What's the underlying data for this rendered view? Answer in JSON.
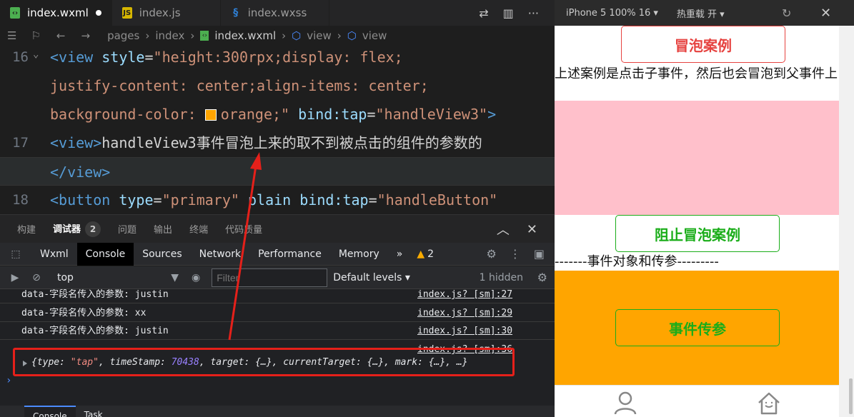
{
  "editor_tabs": [
    {
      "label": "index.wxml",
      "icon": "wxml-file-icon",
      "active": true,
      "dirty": true
    },
    {
      "label": "index.js",
      "icon": "js-file-icon",
      "active": false
    },
    {
      "label": "index.wxss",
      "icon": "wxss-file-icon",
      "active": false
    }
  ],
  "breadcrumb": {
    "items": [
      "pages",
      "index",
      "index.wxml",
      "view",
      "view"
    ]
  },
  "code": {
    "lines": [
      {
        "num": "16",
        "text": "<view style=\"height:300rpx;display: flex;"
      },
      {
        "num": "",
        "text": "justify-content: center;align-items: center;"
      },
      {
        "num": "",
        "text": "background-color: orange;\" bind:tap=\"handleView3\">"
      },
      {
        "num": "17",
        "text": "<view>handleView3事件冒泡上来的取不到被点击的组件的参数的"
      },
      {
        "num": "",
        "text": "</view>"
      },
      {
        "num": "18",
        "text": "<button type=\"primary\" plain bind:tap=\"handleButton\""
      }
    ],
    "line16": {
      "tag_open": "<view",
      "attr": "style",
      "eq": "=",
      "val1": "\"height:300rpx;display: flex;"
    },
    "line16b": "justify-content: center;align-items: center;",
    "line16c": {
      "prefix": "background-color: ",
      "color_word": "orange",
      "suffix": ";\"",
      "attr": "bind:tap",
      "eq": "=",
      "val": "\"handleView3\"",
      "close": ">"
    },
    "line17": {
      "tag": "<view>",
      "text": "handleView3事件冒泡上来的取不到被点击的组件的参数的"
    },
    "line17b": "</view>",
    "line18": {
      "tag_open": "<button",
      "attr1": "type",
      "eq": "=",
      "val1": "\"primary\"",
      "attr2": "plain",
      "attr3": "bind:tap",
      "val3": "\"handleButton\""
    },
    "swatch_color": "#ffa500"
  },
  "panel": {
    "tabs": [
      "构建",
      "调试器",
      "问题",
      "输出",
      "终端",
      "代码质量"
    ],
    "active_tab": "调试器",
    "debugger_badge": "2"
  },
  "devtools": {
    "tabs": [
      "Wxml",
      "Console",
      "Sources",
      "Network",
      "Performance",
      "Memory"
    ],
    "active": "Console",
    "more": "»",
    "warning_count": "2"
  },
  "console_toolbar": {
    "context": "top",
    "filter_placeholder": "Filter",
    "levels": "Default levels",
    "hidden": "1 hidden"
  },
  "console_logs": [
    {
      "msg": "data-字段名传入的参数: justin",
      "src": "index.js? [sm]:27"
    },
    {
      "msg": "data-字段名传入的参数: xx",
      "src": "index.js? [sm]:29"
    },
    {
      "msg": "data-字段名传入的参数: justin",
      "src": "index.js? [sm]:30"
    }
  ],
  "console_obj": {
    "src": "index.js? [sm]:36",
    "open": "{",
    "k1": "type: ",
    "v1": "\"tap\"",
    "k2": ", timeStamp: ",
    "v2": "70438",
    "rest": ", target: {…}, currentTarget: {…}, mark: {…}, …}"
  },
  "bottom_tabs": [
    "Console",
    "Task"
  ],
  "simulator": {
    "device": "iPhone 5 100% 16 ▾",
    "hot_reload": "热重载 开 ▾",
    "btn_bubble": "冒泡案例",
    "desc": "上述案例是点击子事件，然后也会冒泡到父事件上",
    "btn_stop": "阻止冒泡案例",
    "divider": "-------事件对象和传参---------",
    "btn_param": "事件传参",
    "tab_icons": [
      "user-icon",
      "home-icon"
    ]
  },
  "colors": {
    "pink": "#ffc0cb",
    "orange": "#ffa500",
    "warn_red": "#e64340",
    "primary_green": "#1aad19",
    "annotation_red": "#e5201a"
  }
}
